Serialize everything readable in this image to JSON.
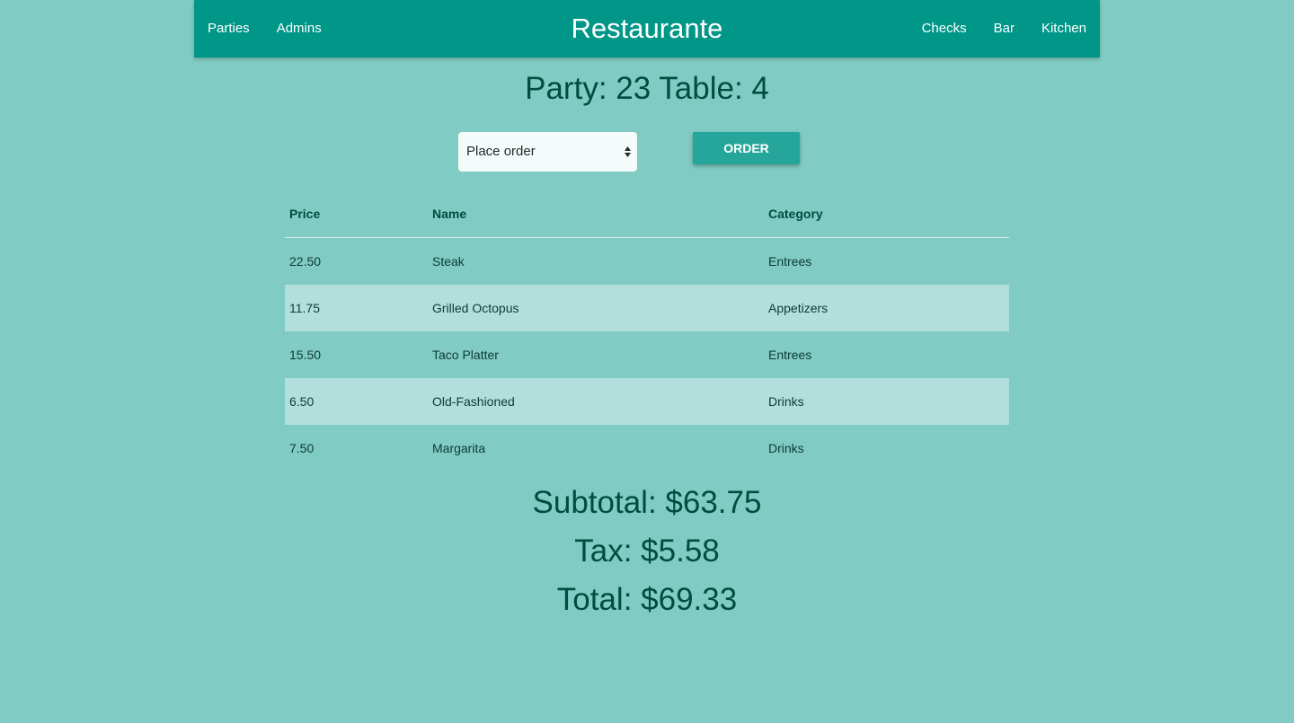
{
  "nav": {
    "brand": "Restaurante",
    "left_links": [
      "Parties",
      "Admins"
    ],
    "right_links": [
      "Checks",
      "Bar",
      "Kitchen"
    ]
  },
  "header": {
    "title": "Party: 23 Table: 4"
  },
  "order_form": {
    "select_value": "Place order",
    "button_label": "ORDER"
  },
  "table": {
    "columns": [
      "Price",
      "Name",
      "Category"
    ],
    "rows": [
      {
        "price": "22.50",
        "name": "Steak",
        "category": "Entrees"
      },
      {
        "price": "11.75",
        "name": "Grilled Octopus",
        "category": "Appetizers"
      },
      {
        "price": "15.50",
        "name": "Taco Platter",
        "category": "Entrees"
      },
      {
        "price": "6.50",
        "name": "Old-Fashioned",
        "category": "Drinks"
      },
      {
        "price": "7.50",
        "name": "Margarita",
        "category": "Drinks"
      }
    ]
  },
  "totals": {
    "subtotal": "Subtotal: $63.75",
    "tax": "Tax: $5.58",
    "total": "Total: $69.33"
  },
  "colors": {
    "page_background": "#80cbc4",
    "navbar": "#009688",
    "button": "#26a69a",
    "striped_row": "#b2dfdb",
    "text": "#004d40"
  }
}
